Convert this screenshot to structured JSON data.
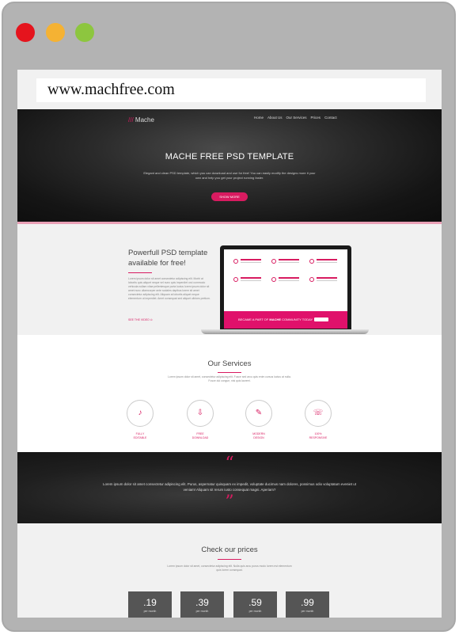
{
  "browser": {
    "url": "www.machfree.com",
    "controls": {
      "close_color": "#e5141d",
      "minimize_color": "#f5b233",
      "maximize_color": "#8dc63f"
    }
  },
  "header": {
    "logo_prefix": "///",
    "logo_text": "Mache",
    "nav": [
      "Home",
      "About Us",
      "Our Services",
      "Prices",
      "Contact"
    ]
  },
  "hero": {
    "title": "MACHE FREE PSD TEMPLATE",
    "subtitle": "Elegant and clean PSD template, which you can download and use for free! You can easily modify the designs more it your own and help you get your project running faster.",
    "button": "SHOW MORE"
  },
  "about": {
    "title": "Powerfull PSD template available for free!",
    "text": "Lorem ipsum dolor sit amet consectetur adipiscing elit. Morbi at lobortis quis aliquet neque vel nunc quis imperdiet orci commodo vehicula nullam vitae pellentesque porta luctus lorem ipsum dolor sit amet nunc ullamcorper ante sodales dapibus lorem sit amet consectetur adipiscing elit. Aliquam at lobortis aliquet neque elementum ut imperdiet. Amet consequat sed aliquet ultrices pretium.",
    "link": "SEE THE VIDEO",
    "laptop_banner_prefix": "BECAME A PART OF",
    "laptop_banner_brand": "MACHE",
    "laptop_banner_suffix": "COMMUNITY TODAY"
  },
  "services": {
    "title": "Our Services",
    "text": "Lorem ipsum dolor sit amet, consectetur adipiscing elit. Fusce sed arcu quis enim cursus luctus at nulla. Fusce dui congue, nisi quis laoreet.",
    "items": [
      {
        "icon": "headphones-icon",
        "glyph": "♪",
        "label_1": "FULLY",
        "label_2": "EDITABLE"
      },
      {
        "icon": "download-icon",
        "glyph": "⇩",
        "label_1": "FREE",
        "label_2": "DOWNLOAD"
      },
      {
        "icon": "pen-icon",
        "glyph": "✎",
        "label_1": "MODERN",
        "label_2": "DESIGN"
      },
      {
        "icon": "phone-icon",
        "glyph": "☏",
        "label_1": "100%",
        "label_2": "RESPONSIVE"
      }
    ]
  },
  "quote": {
    "open_mark": "“",
    "text": "Lorem ipsum dolor sit amet consectetur adipiscing elit. Purus, aspernatur quisquam ex impedit, voluptate ducimus nam dolores, possimus odio voluptatum eveniet ut veniam! Aliquam sit rerum iusto consequat magni. Aperiam?",
    "close_mark": "”"
  },
  "prices": {
    "title": "Check our prices",
    "text": "Lorem ipsum dolor sit amet, consectetur adipiscing elit. Nulla quis arcu purus modo lorem est elementum quis lorem consequat.",
    "plans": [
      {
        "price": ".19",
        "period": "per month"
      },
      {
        "price": ".39",
        "period": "per month"
      },
      {
        "price": ".59",
        "period": "per month"
      },
      {
        "price": ".99",
        "period": "per month"
      }
    ]
  },
  "colors": {
    "accent": "#d81b60",
    "banner": "#e0116b",
    "dark": "#151515"
  }
}
